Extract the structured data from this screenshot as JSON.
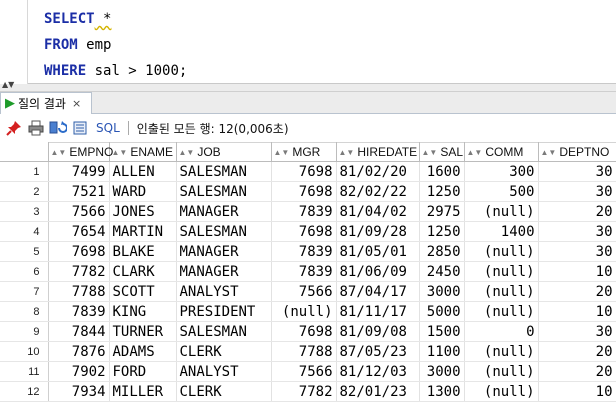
{
  "editor": {
    "line1": {
      "kw": "SELECT",
      "rest": " *"
    },
    "line2": {
      "kw": "FROM",
      "rest": " emp"
    },
    "line3": {
      "kw": "WHERE",
      "rest": " sal > 1000;"
    }
  },
  "results_tab": {
    "label": "질의 결과",
    "close": "×"
  },
  "toolbar": {
    "pin_icon": "pin-icon",
    "print_icon": "print-icon",
    "refresh_icon": "refresh-icon",
    "export_icon": "export-icon",
    "sql_label": "SQL",
    "status": "인출된 모든 행: 12(0,006초)"
  },
  "grid": {
    "columns": [
      "EMPNO",
      "ENAME",
      "JOB",
      "MGR",
      "HIREDATE",
      "SAL",
      "COMM",
      "DEPTNO"
    ],
    "rows": [
      {
        "n": "1",
        "empno": "7499",
        "ename": "ALLEN",
        "job": "SALESMAN",
        "mgr": "7698",
        "hiredate": "81/02/20",
        "sal": "1600",
        "comm": "300",
        "deptno": "30"
      },
      {
        "n": "2",
        "empno": "7521",
        "ename": "WARD",
        "job": "SALESMAN",
        "mgr": "7698",
        "hiredate": "82/02/22",
        "sal": "1250",
        "comm": "500",
        "deptno": "30"
      },
      {
        "n": "3",
        "empno": "7566",
        "ename": "JONES",
        "job": "MANAGER",
        "mgr": "7839",
        "hiredate": "81/04/02",
        "sal": "2975",
        "comm": "(null)",
        "deptno": "20"
      },
      {
        "n": "4",
        "empno": "7654",
        "ename": "MARTIN",
        "job": "SALESMAN",
        "mgr": "7698",
        "hiredate": "81/09/28",
        "sal": "1250",
        "comm": "1400",
        "deptno": "30"
      },
      {
        "n": "5",
        "empno": "7698",
        "ename": "BLAKE",
        "job": "MANAGER",
        "mgr": "7839",
        "hiredate": "81/05/01",
        "sal": "2850",
        "comm": "(null)",
        "deptno": "30"
      },
      {
        "n": "6",
        "empno": "7782",
        "ename": "CLARK",
        "job": "MANAGER",
        "mgr": "7839",
        "hiredate": "81/06/09",
        "sal": "2450",
        "comm": "(null)",
        "deptno": "10"
      },
      {
        "n": "7",
        "empno": "7788",
        "ename": "SCOTT",
        "job": "ANALYST",
        "mgr": "7566",
        "hiredate": "87/04/17",
        "sal": "3000",
        "comm": "(null)",
        "deptno": "20"
      },
      {
        "n": "8",
        "empno": "7839",
        "ename": "KING",
        "job": "PRESIDENT",
        "mgr": "(null)",
        "hiredate": "81/11/17",
        "sal": "5000",
        "comm": "(null)",
        "deptno": "10"
      },
      {
        "n": "9",
        "empno": "7844",
        "ename": "TURNER",
        "job": "SALESMAN",
        "mgr": "7698",
        "hiredate": "81/09/08",
        "sal": "1500",
        "comm": "0",
        "deptno": "30"
      },
      {
        "n": "10",
        "empno": "7876",
        "ename": "ADAMS",
        "job": "CLERK",
        "mgr": "7788",
        "hiredate": "87/05/23",
        "sal": "1100",
        "comm": "(null)",
        "deptno": "20"
      },
      {
        "n": "11",
        "empno": "7902",
        "ename": "FORD",
        "job": "ANALYST",
        "mgr": "7566",
        "hiredate": "81/12/03",
        "sal": "3000",
        "comm": "(null)",
        "deptno": "20"
      },
      {
        "n": "12",
        "empno": "7934",
        "ename": "MILLER",
        "job": "CLERK",
        "mgr": "7782",
        "hiredate": "82/01/23",
        "sal": "1300",
        "comm": "(null)",
        "deptno": "10"
      }
    ]
  }
}
